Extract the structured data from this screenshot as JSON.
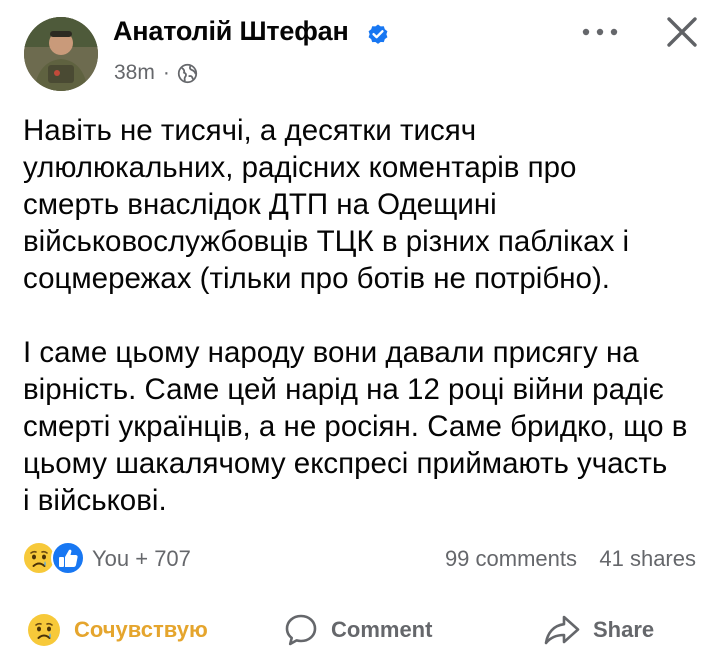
{
  "post": {
    "author": "Анатолій Штефан",
    "time": "38m",
    "separator": "·",
    "paragraphs": [
      [
        "Навіть не тисячі, а десятки тисяч",
        "улюлюкальних, радісних коментарів про",
        "смерть внаслідок ДТП на Одещині",
        "військовослужбовців ТЦК в різних пабліках і",
        "соцмережах (тільки про ботів не потрібно)."
      ],
      [
        "І саме цьому народу вони давали присягу на",
        "вірність. Саме цей нарід на 12 році війни радіє",
        "смерті українців, а не росіян. Саме бридко, що в",
        "цьому шакалячому експресі приймають участь",
        "і військові."
      ]
    ]
  },
  "stats": {
    "reactions": "You + 707",
    "comments": "99 comments",
    "shares": "41 shares"
  },
  "actions": {
    "react_label": "Сочувствую",
    "comment_label": "Comment",
    "share_label": "Share"
  },
  "icons": {
    "verified": "verified-badge-icon",
    "audience": "globe-icon",
    "more": "more-dots-icon",
    "close": "close-icon",
    "reaction_1": "sad-face-icon",
    "reaction_2": "like-thumb-icon",
    "comment": "comment-bubble-icon",
    "share": "share-arrow-icon"
  },
  "colors": {
    "verified_blue": "#1877f2",
    "secondary_text": "#65676b",
    "react_active": "#e5a52d",
    "sad_yellow": "#f7c93a",
    "like_blue": "#1877f2"
  }
}
